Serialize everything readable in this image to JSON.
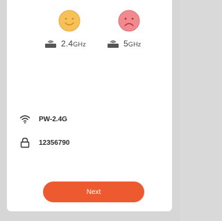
{
  "bands": [
    {
      "label_main": "2.4",
      "label_suffix": "GHz",
      "status": "happy",
      "face_color": "#f7c15a",
      "face_stroke": "#e09a24"
    },
    {
      "label_main": "5",
      "label_suffix": "GHz",
      "status": "sad",
      "face_color": "#f08a8f",
      "face_stroke": "#d8535b"
    }
  ],
  "wifi": {
    "ssid": "PW-2.4G",
    "ssid_trailing": "",
    "password": "12356790",
    "password_trailing": ""
  },
  "actions": {
    "next_label": "Next"
  },
  "colors": {
    "accent": "#ee5a2f"
  },
  "icons": {
    "wifi": "wifi-icon",
    "lock": "lock-icon",
    "router": "router-icon",
    "happy": "happy-face-icon",
    "sad": "sad-face-icon"
  }
}
